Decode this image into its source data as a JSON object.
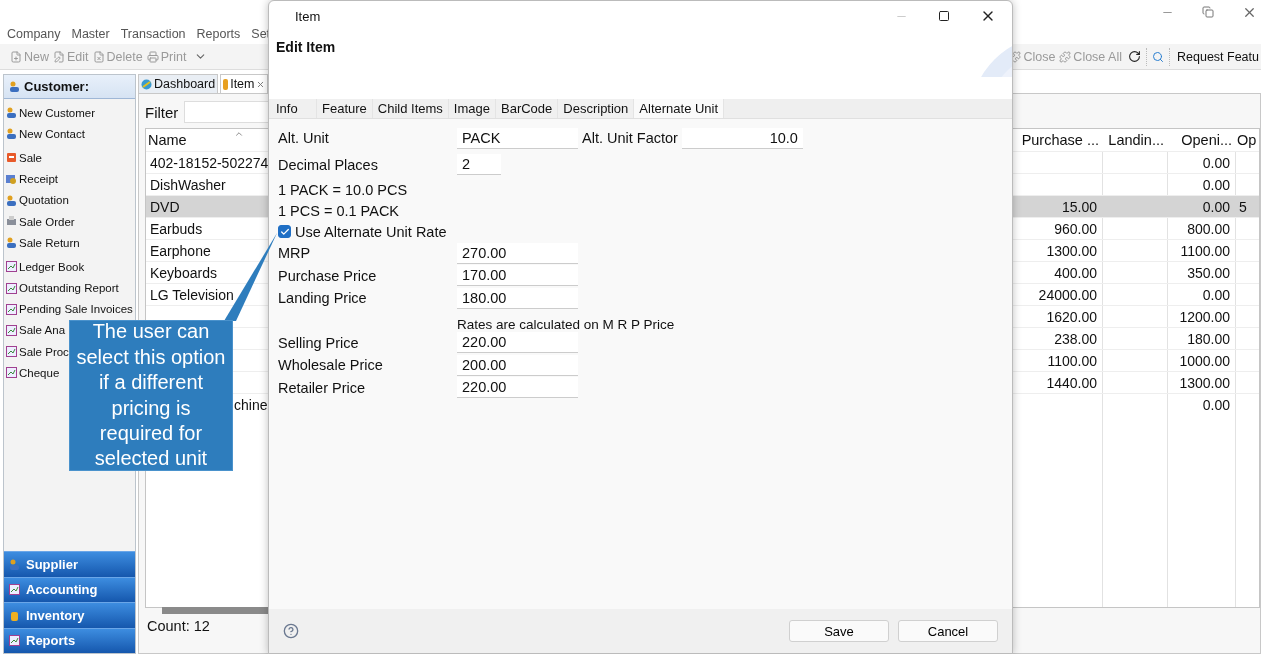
{
  "app": {
    "menu": [
      "Company",
      "Master",
      "Transaction",
      "Reports",
      "Set"
    ],
    "toolbar_left": [
      {
        "label": "New",
        "kind": "new",
        "disabled": true
      },
      {
        "label": "Edit",
        "kind": "edit",
        "disabled": true
      },
      {
        "label": "Delete",
        "kind": "delete",
        "disabled": true
      },
      {
        "label": "Print",
        "kind": "print",
        "disabled": true
      }
    ],
    "toolbar_right": [
      {
        "label": "Close",
        "kind": "close",
        "disabled": true
      },
      {
        "label": "Close All",
        "kind": "close",
        "disabled": true
      }
    ],
    "request_button": "Request Featu"
  },
  "sidebar": {
    "header": "Customer:",
    "item_groups": [
      [
        {
          "label": "New Customer",
          "kind": "person"
        },
        {
          "label": "New Contact",
          "kind": "person"
        }
      ],
      [
        {
          "label": "Sale",
          "kind": "sale"
        },
        {
          "label": "Receipt",
          "kind": "receipt"
        },
        {
          "label": "Quotation",
          "kind": "person"
        },
        {
          "label": "Sale Order",
          "kind": "order"
        },
        {
          "label": "Sale Return",
          "kind": "person"
        }
      ],
      [
        {
          "label": "Ledger Book",
          "kind": "report"
        },
        {
          "label": "Outstanding Report",
          "kind": "report"
        },
        {
          "label": "Pending Sale Invoices",
          "kind": "report"
        },
        {
          "label": "Sale Ana",
          "kind": "report"
        },
        {
          "label": "Sale Proc",
          "kind": "report"
        },
        {
          "label": "Cheque",
          "kind": "report"
        }
      ]
    ],
    "sections": [
      {
        "label": "Supplier",
        "kind": "person"
      },
      {
        "label": "Accounting",
        "kind": "report"
      },
      {
        "label": "Inventory",
        "kind": "inventory"
      },
      {
        "label": "Reports",
        "kind": "report"
      }
    ]
  },
  "tabs": [
    {
      "label": "Dashboard",
      "selected": false,
      "closable": false
    },
    {
      "label": "Item",
      "selected": true,
      "closable": true
    }
  ],
  "filter": {
    "label": "Filter"
  },
  "table": {
    "columns": [
      "Name",
      "Purchase ...",
      "Landin...",
      "Openi...",
      "Op"
    ],
    "rows": [
      {
        "selected": false,
        "cells": [
          "402-18152-502274",
          "",
          "",
          "0.00",
          ""
        ]
      },
      {
        "selected": false,
        "cells": [
          "DishWasher",
          "",
          "",
          "0.00",
          ""
        ]
      },
      {
        "selected": true,
        "cells": [
          "DVD",
          "15.00",
          "",
          "0.00",
          "5"
        ]
      },
      {
        "selected": false,
        "cells": [
          "Earbuds",
          "960.00",
          "",
          "800.00",
          ""
        ]
      },
      {
        "selected": false,
        "cells": [
          "Earphone",
          "1300.00",
          "",
          "1100.00",
          ""
        ]
      },
      {
        "selected": false,
        "cells": [
          "Keyboards",
          "400.00",
          "",
          "350.00",
          ""
        ]
      },
      {
        "selected": false,
        "cells": [
          "LG Television",
          "24000.00",
          "",
          "0.00",
          ""
        ]
      },
      {
        "selected": false,
        "cells": [
          "",
          "1620.00",
          "",
          "1200.00",
          ""
        ]
      },
      {
        "selected": false,
        "cells": [
          "",
          "238.00",
          "",
          "180.00",
          ""
        ]
      },
      {
        "selected": false,
        "cells": [
          "",
          "1100.00",
          "",
          "1000.00",
          ""
        ]
      },
      {
        "selected": false,
        "cells": [
          "",
          "1440.00",
          "",
          "1300.00",
          ""
        ]
      },
      {
        "selected": false,
        "kind": "tail",
        "cells": [
          "chine",
          "",
          "",
          "0.00",
          ""
        ]
      }
    ]
  },
  "count": "Count: 12",
  "dialog": {
    "title": "Item",
    "heading": "Edit Item",
    "tabs": [
      {
        "label": "Info",
        "selected": false
      },
      {
        "label": "Feature",
        "selected": false
      },
      {
        "label": "Child Items",
        "selected": false
      },
      {
        "label": "Image",
        "selected": false
      },
      {
        "label": "BarCode",
        "selected": false
      },
      {
        "label": "Description",
        "selected": false
      },
      {
        "label": "Alternate Unit",
        "selected": true
      }
    ],
    "alt_unit": {
      "label": "Alt. Unit",
      "value": "PACK"
    },
    "alt_factor": {
      "label": "Alt. Unit Factor",
      "value": "10.0"
    },
    "decimal_places": {
      "label": "Decimal Places",
      "value": "2"
    },
    "conversions": [
      "1 PACK  = 10.0 PCS",
      "1 PCS = 0.1 PACK"
    ],
    "use_rate": {
      "label": "Use Alternate Unit Rate",
      "checked": true
    },
    "prices_top": [
      {
        "label": "MRP",
        "value": "270.00"
      },
      {
        "label": "Purchase Price",
        "value": "170.00"
      },
      {
        "label": "Landing Price",
        "value": "180.00"
      }
    ],
    "note": "Rates are calculated on M R P Price",
    "prices_bottom": [
      {
        "label": "Selling Price",
        "value": "220.00"
      },
      {
        "label": "Wholesale Price",
        "value": "200.00"
      },
      {
        "label": "Retailer Price",
        "value": "220.00"
      }
    ],
    "buttons": [
      "Save",
      "Cancel"
    ]
  },
  "callout": {
    "text": "The user can select this option if a different pricing is required for selected unit"
  }
}
